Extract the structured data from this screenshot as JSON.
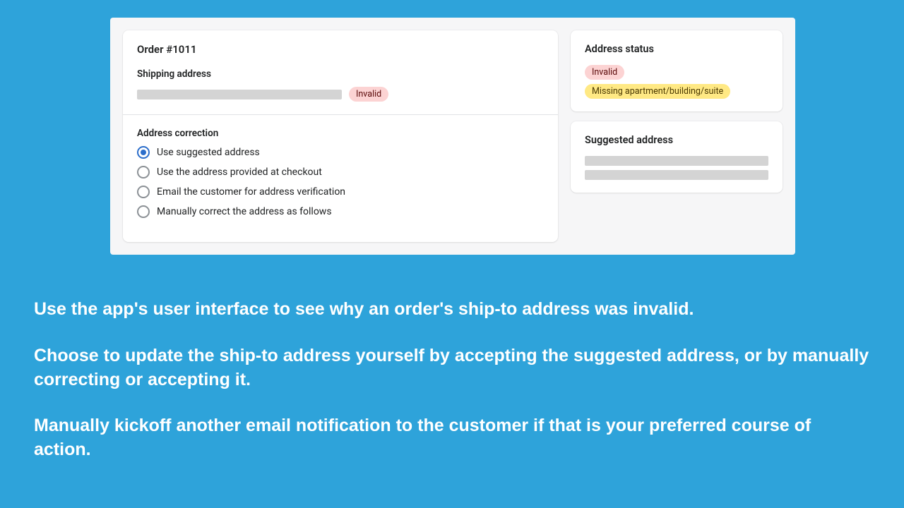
{
  "order": {
    "title": "Order #1011",
    "shipping_label": "Shipping address",
    "invalid_badge": "Invalid"
  },
  "correction": {
    "title": "Address correction",
    "options": [
      "Use suggested address",
      "Use the address provided at checkout",
      "Email the customer for address verification",
      "Manually correct the address as follows"
    ],
    "selected_index": 0
  },
  "status": {
    "title": "Address status",
    "badges": {
      "invalid": "Invalid",
      "missing": "Missing apartment/building/suite"
    }
  },
  "suggested": {
    "title": "Suggested address"
  },
  "marketing": {
    "p1": "Use the app's user interface to see why an order's ship-to address was invalid.",
    "p2": "Choose to update the ship-to address yourself by accepting the suggested address, or by manually correcting or accepting it.",
    "p3": "Manually kickoff another email notification to the customer if that is your preferred course of action."
  }
}
